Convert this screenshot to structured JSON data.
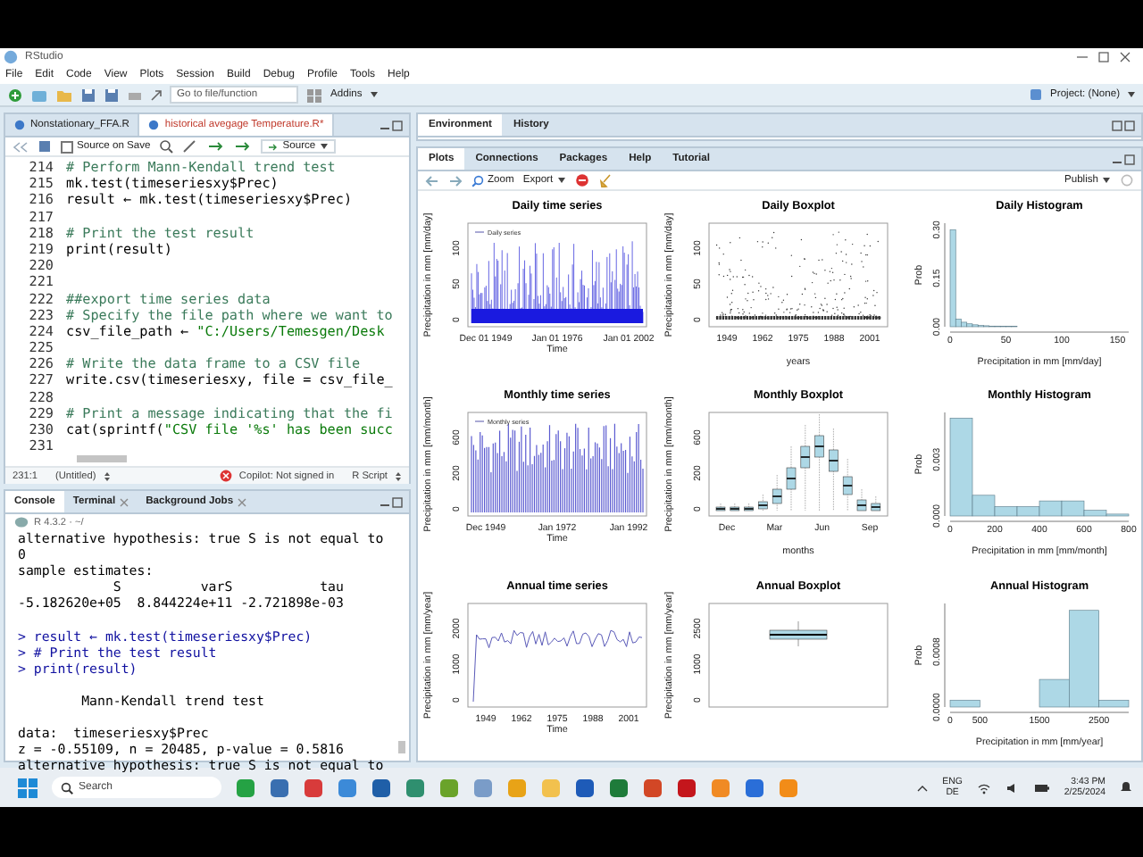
{
  "window": {
    "title": "RStudio"
  },
  "menu": [
    "File",
    "Edit",
    "Code",
    "View",
    "Plots",
    "Session",
    "Build",
    "Debug",
    "Profile",
    "Tools",
    "Help"
  ],
  "toolbar": {
    "goto_placeholder": "Go to file/function",
    "addins": "Addins",
    "project": "Project: (None)"
  },
  "editor": {
    "tabs": [
      {
        "label": "Nonstationary_FFA.R",
        "selected": false
      },
      {
        "label": "historical avegage Temperature.R*",
        "selected": true
      }
    ],
    "source_on_save": {
      "label": "Source on Save",
      "checked": false
    },
    "source_button": "Source",
    "lines": [
      {
        "number": "214",
        "parts": [
          {
            "kind": "comment",
            "text": "# Perform Mann-Kendall trend test"
          }
        ]
      },
      {
        "number": "215",
        "parts": [
          {
            "kind": "code",
            "text": "mk.test(timeseriesxy$Prec)"
          }
        ]
      },
      {
        "number": "216",
        "parts": [
          {
            "kind": "code",
            "text": "result ← mk.test(timeseriesxy$Prec)"
          }
        ]
      },
      {
        "number": "217"
      },
      {
        "number": "218",
        "parts": [
          {
            "kind": "comment",
            "text": "# Print the test result"
          }
        ]
      },
      {
        "number": "219",
        "parts": [
          {
            "kind": "code",
            "text": "print(result)"
          }
        ]
      },
      {
        "number": "220"
      },
      {
        "number": "221"
      },
      {
        "number": "222",
        "parts": [
          {
            "kind": "comment",
            "text": "##export time series data"
          }
        ]
      },
      {
        "number": "223",
        "parts": [
          {
            "kind": "comment",
            "text": "# Specify the file path where we want to"
          }
        ]
      },
      {
        "number": "224",
        "parts": [
          {
            "kind": "code",
            "text": "csv_file_path ← "
          },
          {
            "kind": "string",
            "text": "\"C:/Users/Temesgen/Desk"
          }
        ]
      },
      {
        "number": "225"
      },
      {
        "number": "226",
        "parts": [
          {
            "kind": "comment",
            "text": "# Write the data frame to a CSV file"
          }
        ]
      },
      {
        "number": "227",
        "parts": [
          {
            "kind": "code",
            "text": "write.csv(timeseriesxy, file = csv_file_"
          }
        ]
      },
      {
        "number": "228"
      },
      {
        "number": "229",
        "parts": [
          {
            "kind": "comment",
            "text": "# Print a message indicating that the fi"
          }
        ]
      },
      {
        "number": "230",
        "parts": [
          {
            "kind": "code",
            "text": "cat(sprintf("
          },
          {
            "kind": "string",
            "text": "\"CSV file '%s' has been succ"
          }
        ]
      },
      {
        "number": "231"
      }
    ],
    "status": {
      "position": "231:1",
      "scope": "(Untitled)",
      "copilot": "Copilot: Not signed in",
      "filetype": "R Script"
    }
  },
  "console": {
    "tabs": [
      {
        "label": "Console",
        "selected": true,
        "closable": false
      },
      {
        "label": "Terminal",
        "selected": false,
        "closable": true
      },
      {
        "label": "Background Jobs",
        "selected": false,
        "closable": true
      }
    ],
    "path": "R 4.3.2 · ~/",
    "lines": [
      {
        "kind": "output",
        "text": "alternative hypothesis: true S is not equal to"
      },
      {
        "kind": "output",
        "text": "0"
      },
      {
        "kind": "output",
        "text": "sample estimates:"
      },
      {
        "kind": "output",
        "text": "            S          varS           tau"
      },
      {
        "kind": "output",
        "text": "-5.182620e+05  8.844224e+11 -2.721898e-03"
      },
      {
        "kind": "blank"
      },
      {
        "kind": "command",
        "text": "> result ← mk.test(timeseriesxy$Prec)"
      },
      {
        "kind": "command",
        "text": "> # Print the test result"
      },
      {
        "kind": "command",
        "text": "> print(result)"
      },
      {
        "kind": "blank"
      },
      {
        "kind": "output",
        "text": "        Mann-Kendall trend test"
      },
      {
        "kind": "blank"
      },
      {
        "kind": "output",
        "text": "data:  timeseriesxy$Prec"
      },
      {
        "kind": "output",
        "text": "z = -0.55109, n = 20485, p-value = 0.5816"
      },
      {
        "kind": "output",
        "text": "alternative hypothesis: true S is not equal to"
      }
    ]
  },
  "environment_tabs": [
    {
      "label": "Environment",
      "selected": true
    },
    {
      "label": "History",
      "selected": false
    }
  ],
  "plots_pane": {
    "tabs": [
      {
        "label": "Plots",
        "selected": true
      },
      {
        "label": "Connections",
        "selected": false
      },
      {
        "label": "Packages",
        "selected": false
      },
      {
        "label": "Help",
        "selected": false
      },
      {
        "label": "Tutorial",
        "selected": false
      }
    ],
    "zoom": "Zoom",
    "export": "Export",
    "publish": "Publish"
  },
  "plots": [
    {
      "kind": "daily-series",
      "title": "Daily time series",
      "ylabel": "Precipitation in mm [mm/day]",
      "xlabel": "Time",
      "xticks": [
        "Dec 01 1949",
        "Jan 01 1976",
        "Jan 01 2002"
      ],
      "yticks": [
        "0",
        "50",
        "100"
      ],
      "legend": "Daily series"
    },
    {
      "kind": "scatter-boxplot",
      "title": "Daily Boxplot",
      "ylabel": "Precipitation in mm [mm/day]",
      "xlabel": "years",
      "xticks": [
        "1949",
        "1962",
        "1975",
        "1988",
        "2001"
      ],
      "yticks": [
        "0",
        "50",
        "100"
      ]
    },
    {
      "kind": "histogram",
      "chart_data": {
        "type": "bar",
        "title": "Daily Histogram",
        "xlabel": "Precipitation in mm [mm/day]",
        "ylabel": "Prob",
        "x": [
          2.5,
          7.5,
          12.5,
          17.5,
          22.5,
          27.5,
          32.5,
          37.5,
          42.5,
          47.5,
          52.5,
          57.5
        ],
        "values": [
          0.3,
          0.024,
          0.014,
          0.009,
          0.006,
          0.004,
          0.003,
          0.002,
          0.002,
          0.001,
          0.001,
          0.001
        ],
        "xlim": [
          0,
          160
        ],
        "ylim": [
          0,
          0.32
        ],
        "xticks": [
          0,
          50,
          100,
          150
        ],
        "yticks": [
          {
            "value": 0,
            "label": "0.00"
          },
          {
            "value": 0.15,
            "label": "0.15"
          },
          {
            "value": 0.3,
            "label": "0.30"
          }
        ]
      }
    },
    {
      "kind": "monthly-series",
      "title": "Monthly time series",
      "ylabel": "Precipitation in mm [mm/month]",
      "xlabel": "Time",
      "xticks": [
        "Dec 1949",
        "Jan 1972",
        "Jan 1992"
      ],
      "yticks": [
        "0",
        "200",
        "600"
      ],
      "legend": "Monthly series"
    },
    {
      "kind": "monthly-boxplot",
      "title": "Monthly Boxplot",
      "ylabel": "Precipitation in mm [mm/month]",
      "xlabel": "months",
      "xticks": [
        "Dec",
        "Mar",
        "Jun",
        "Sep"
      ],
      "yticks": [
        "0",
        "200",
        "600"
      ]
    },
    {
      "kind": "histogram",
      "chart_data": {
        "type": "bar",
        "title": "Monthly Histogram",
        "xlabel": "Precipitation in mm [mm/month]",
        "ylabel": "Prob",
        "x": [
          50,
          150,
          250,
          350,
          450,
          550,
          650,
          750
        ],
        "values": [
          0.0052,
          0.0011,
          0.0005,
          0.0005,
          0.0008,
          0.0008,
          0.0003,
          0.0001
        ],
        "xlim": [
          0,
          800
        ],
        "ylim": [
          0,
          0.0055
        ],
        "xticks": [
          0,
          200,
          400,
          600,
          800
        ],
        "yticks": [
          {
            "value": 0,
            "label": "0.000"
          },
          {
            "value": 0.003,
            "label": "0.003"
          }
        ]
      }
    },
    {
      "kind": "annual-series",
      "title": "Annual time series",
      "ylabel": "Precipitation in mm [mm/year]",
      "xlabel": "Time",
      "xticks": [
        "1949",
        "1962",
        "1975",
        "1988",
        "2001"
      ],
      "yticks": [
        "0",
        "1000",
        "2000"
      ]
    },
    {
      "kind": "annual-boxplot",
      "title": "Annual Boxplot",
      "ylabel": "Precipitation in mm [mm/year]",
      "yticks": [
        "0",
        "1000",
        "2500"
      ]
    },
    {
      "kind": "histogram",
      "chart_data": {
        "type": "bar",
        "title": "Annual Histogram",
        "xlabel": "Precipitation in mm [mm/year]",
        "ylabel": "Prob",
        "x": [
          250,
          750,
          1250,
          1750,
          2250,
          2750
        ],
        "values": [
          0.0001,
          0,
          0,
          0.0004,
          0.0014,
          0.0001
        ],
        "xlim": [
          0,
          3000
        ],
        "ylim": [
          0,
          0.0015
        ],
        "xticks": [
          0,
          500,
          1500,
          2500
        ],
        "yticks": [
          {
            "value": 0,
            "label": "0.0000"
          },
          {
            "value": 0.0008,
            "label": "0.0008"
          }
        ]
      }
    }
  ],
  "taskbar": {
    "search_placeholder": "Search",
    "language": "ENG",
    "layout": "DE",
    "time": "3:43 PM",
    "date": "2/25/2024"
  }
}
